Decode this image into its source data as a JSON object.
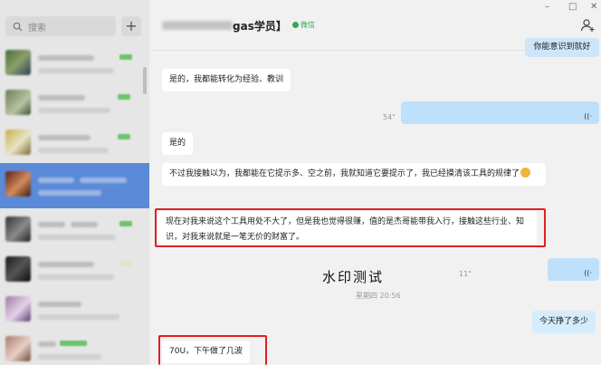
{
  "sidebar": {
    "search_placeholder": "搜索",
    "add_label": "+"
  },
  "header": {
    "title_suffix": "gas学员】",
    "wechat_tag": "微信",
    "window_controls": [
      "–",
      "□",
      "✕"
    ]
  },
  "messages": {
    "out_top": "你能意识到就好",
    "in_1": "是的，我都能转化为经验、教训",
    "voice_1_duration": "54\"",
    "voice_icon": "((·",
    "in_2": "是的",
    "in_3": "不过我接触以为，我都能在它提示多、空之前，我就知道它要提示了，我已经摸清该工具的规律了",
    "in_4": "现在对我来说这个工具用处不大了，但是我也觉得很赚，值的是杰哥能带我入行，接触这些行业、知识，对我来说就是一笔无价的财富了。",
    "voice_2_duration": "11\"",
    "timestamp": "星期四 20:56",
    "out_2": "今天挣了多少",
    "in_5": "70U，下午做了几波"
  },
  "watermark": "水印测试",
  "colors": {
    "highlight_box": "#e01f1f",
    "active_contact": "#5a8ad8",
    "outgoing_bubble": "#cde6fa"
  }
}
